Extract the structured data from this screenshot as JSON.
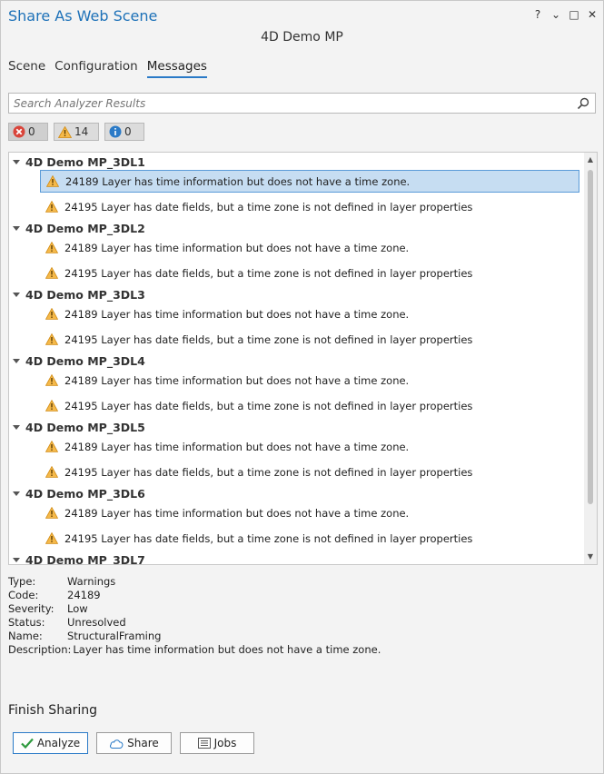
{
  "window": {
    "title": "Share As Web Scene",
    "help_label": "?",
    "menu_label": "⌄",
    "restore_label": "□",
    "close_label": "✕",
    "subtitle": "4D Demo MP"
  },
  "tabs": [
    {
      "label": "Scene",
      "active": false
    },
    {
      "label": "Configuration",
      "active": false
    },
    {
      "label": "Messages",
      "active": true
    }
  ],
  "search": {
    "placeholder": "Search Analyzer Results",
    "icon": "search-icon"
  },
  "filters": {
    "errors": {
      "count": "0",
      "icon": "error-icon"
    },
    "warnings": {
      "count": "14",
      "icon": "warning-icon"
    },
    "info": {
      "count": "0",
      "icon": "info-icon"
    }
  },
  "groups": [
    {
      "name": "4D Demo MP_3DL1",
      "messages": [
        "24189 Layer has time information but does not have a time zone.",
        "24195 Layer has date fields, but a time zone is not defined in layer properties"
      ]
    },
    {
      "name": "4D Demo MP_3DL2",
      "messages": [
        "24189 Layer has time information but does not have a time zone.",
        "24195 Layer has date fields, but a time zone is not defined in layer properties"
      ]
    },
    {
      "name": "4D Demo MP_3DL3",
      "messages": [
        "24189 Layer has time information but does not have a time zone.",
        "24195 Layer has date fields, but a time zone is not defined in layer properties"
      ]
    },
    {
      "name": "4D Demo MP_3DL4",
      "messages": [
        "24189 Layer has time information but does not have a time zone.",
        "24195 Layer has date fields, but a time zone is not defined in layer properties"
      ]
    },
    {
      "name": "4D Demo MP_3DL5",
      "messages": [
        "24189 Layer has time information but does not have a time zone.",
        "24195 Layer has date fields, but a time zone is not defined in layer properties"
      ]
    },
    {
      "name": "4D Demo MP_3DL6",
      "messages": [
        "24189 Layer has time information but does not have a time zone.",
        "24195 Layer has date fields, but a time zone is not defined in layer properties"
      ]
    },
    {
      "name": "4D Demo MP_3DL7",
      "messages": []
    }
  ],
  "details": {
    "type_label": "Type:",
    "type": "Warnings",
    "code_label": "Code:",
    "code": "24189",
    "severity_label": "Severity:",
    "severity": "Low",
    "status_label": "Status:",
    "status": "Unresolved",
    "name_label": "Name:",
    "name": "StructuralFraming",
    "description_label": "Description:",
    "description": "Layer has time information but does not have a time zone."
  },
  "finish": {
    "title": "Finish Sharing"
  },
  "actions": {
    "analyze": "Analyze",
    "share": "Share",
    "jobs": "Jobs"
  },
  "colors": {
    "accent": "#1d71b8",
    "selection": "#c6ddf2",
    "warning": "#f0a30a",
    "error": "#d9443a",
    "info": "#2a7ac7"
  }
}
